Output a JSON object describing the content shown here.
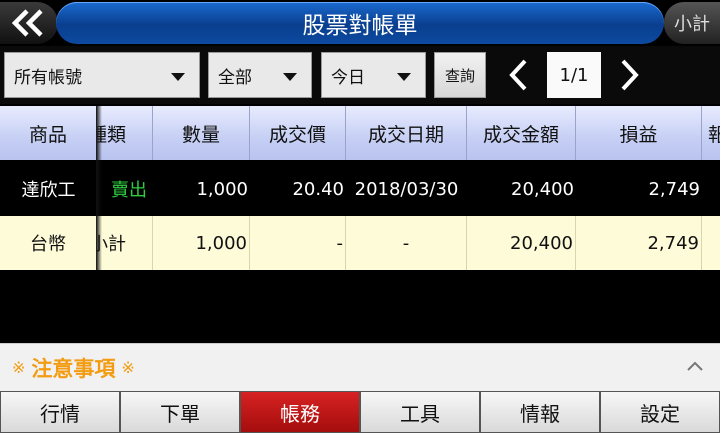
{
  "header": {
    "title": "股票對帳單",
    "subtotal_label": "小計"
  },
  "filters": {
    "account": "所有帳號",
    "type": "全部",
    "period": "今日",
    "query_label": "查詢",
    "page": "1/1"
  },
  "table": {
    "columns": [
      "商品",
      "種類",
      "數量",
      "成交價",
      "成交日期",
      "成交金額",
      "損益",
      "報"
    ],
    "rows": [
      {
        "product": "達欣工",
        "kind": "賣出",
        "qty": "1,000",
        "price": "20.40",
        "date": "2018/03/30",
        "amount": "20,400",
        "pnl": "2,749"
      },
      {
        "product": "台幣",
        "kind": "小計",
        "qty": "1,000",
        "price": "-",
        "date": "-",
        "amount": "20,400",
        "pnl": "2,749"
      }
    ]
  },
  "notice": {
    "label": "注意事項",
    "mark": "※"
  },
  "nav": {
    "items": [
      "行情",
      "下單",
      "帳務",
      "工具",
      "情報",
      "設定"
    ],
    "active": "帳務"
  },
  "colors": {
    "accent": "#0a3e8e",
    "active_tab": "#c41818",
    "sell": "#2ecc40",
    "notice": "#f39c12",
    "highlight_row": "#fdfbd8"
  }
}
